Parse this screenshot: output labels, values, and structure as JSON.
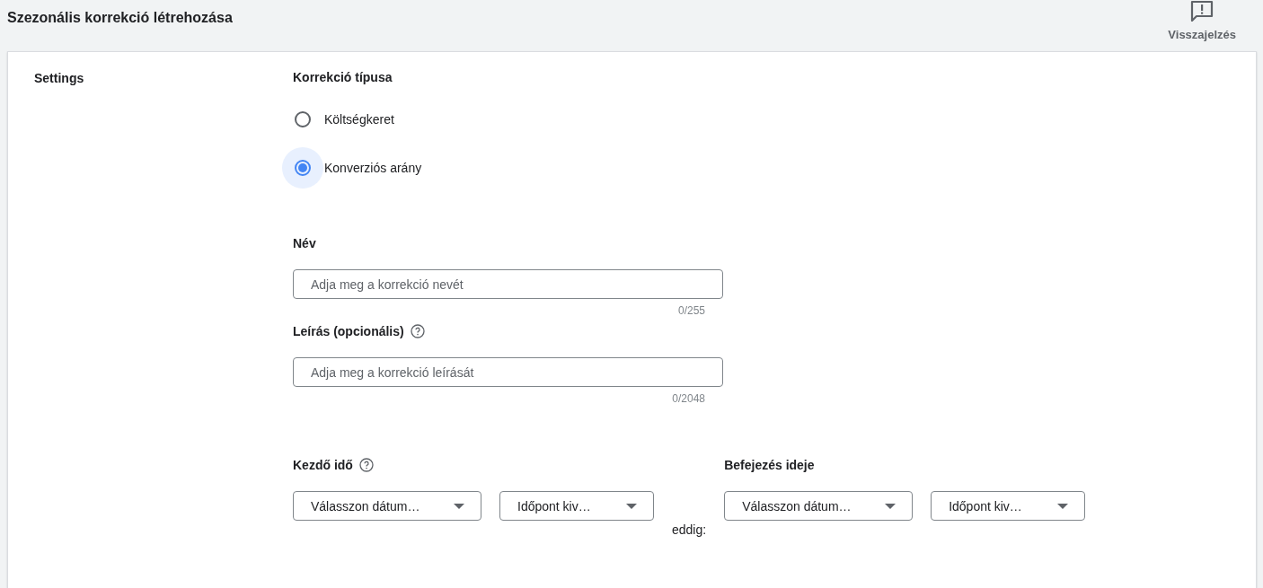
{
  "header": {
    "title": "Szezonális korrekció létrehozása",
    "feedback_label": "Visszajelzés"
  },
  "section_label": "Settings",
  "correction_type": {
    "label": "Korrekció típusa",
    "options": [
      {
        "label": "Költségkeret",
        "selected": false
      },
      {
        "label": "Konverziós arány",
        "selected": true
      }
    ]
  },
  "fields": [
    {
      "label": "Név",
      "help": false,
      "placeholder": "Adja meg a korrekció nevét",
      "counter": "0/255"
    },
    {
      "label": "Leírás (opcionális)",
      "help": true,
      "placeholder": "Adja meg a korrekció leírását",
      "counter": "0/2048"
    }
  ],
  "start": {
    "label": "Kezdő idő",
    "help": true,
    "date_select": "Válasszon dátum…",
    "time_select": "Időpont kiv…"
  },
  "separator": "eddig:",
  "end": {
    "label": "Befejezés ideje",
    "help": false,
    "date_select": "Válasszon dátum…",
    "time_select": "Időpont kiv…"
  }
}
